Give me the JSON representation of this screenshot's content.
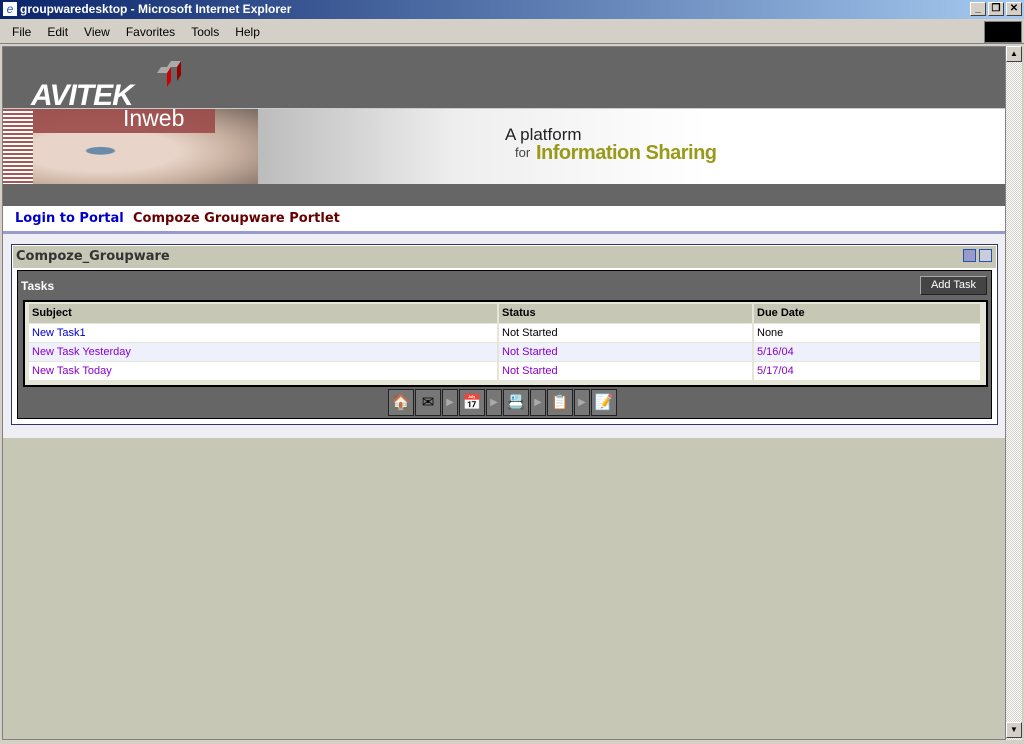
{
  "window": {
    "title": "groupwaredesktop - Microsoft Internet Explorer"
  },
  "menu": [
    "File",
    "Edit",
    "View",
    "Favorites",
    "Tools",
    "Help"
  ],
  "header": {
    "logo": "AVITEK",
    "sublogo": "Inweb",
    "tagline1": "A platform",
    "tagline2": "for",
    "tagline3": "Information Sharing"
  },
  "tabs": [
    {
      "label": "Login to Portal"
    },
    {
      "label": "Compoze Groupware Portlet",
      "active": true
    }
  ],
  "portlet": {
    "title": "Compoze_Groupware",
    "section": "Tasks",
    "add_button": "Add Task",
    "columns": [
      "Subject",
      "Status",
      "Due Date"
    ],
    "rows": [
      {
        "subject": "New Task1",
        "status": "Not Started",
        "due": "None"
      },
      {
        "subject": "New Task Yesterday",
        "status": "Not Started",
        "due": "5/16/04"
      },
      {
        "subject": "New Task Today",
        "status": "Not Started",
        "due": "5/17/04"
      }
    ],
    "nav_icons": [
      "home-icon",
      "mail-icon",
      "calendar-icon",
      "contacts-icon",
      "tasks-icon",
      "notes-icon"
    ]
  },
  "colors": {
    "accent": "#990000",
    "link": "#0000cc",
    "visited": "#8800cc",
    "header": "#666666",
    "background": "#c6c7b5"
  }
}
